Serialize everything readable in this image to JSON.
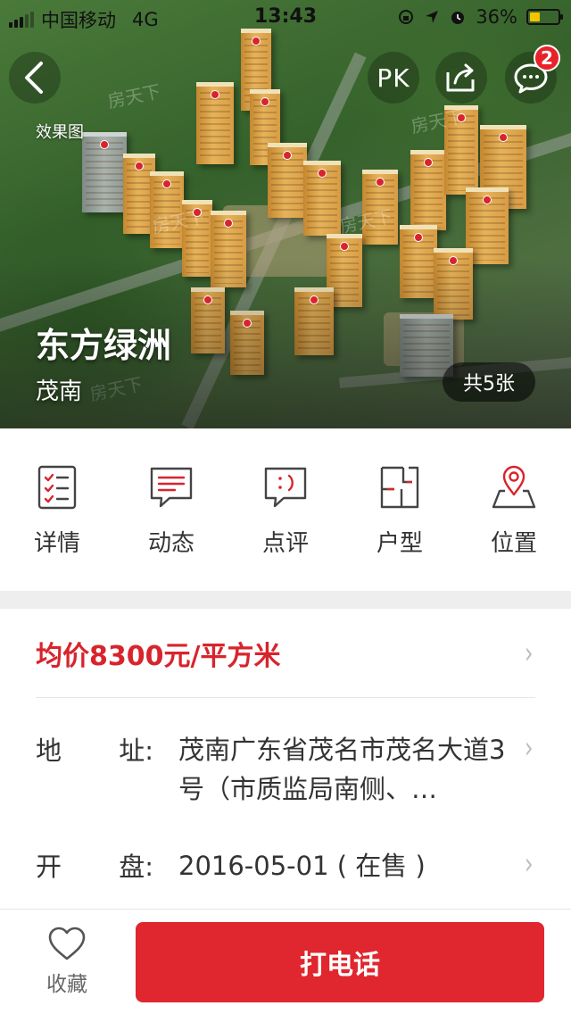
{
  "status_bar": {
    "carrier": "中国移动",
    "network": "4G",
    "time": "13:43",
    "battery": "36%",
    "battery_level": 0.36,
    "battery_color": "#f5c400"
  },
  "hero": {
    "effect_label": "效果图",
    "watermark": "房天下",
    "project_name": "东方绿洲",
    "district": "茂南",
    "photo_count": "共5张",
    "pk_label": "PK",
    "message_badge": "2",
    "icons": [
      "back-arrow-icon",
      "share-icon",
      "message-icon"
    ]
  },
  "quick_nav": [
    {
      "label": "详情",
      "icon": "details-list-icon"
    },
    {
      "label": "动态",
      "icon": "news-chat-icon"
    },
    {
      "label": "点评",
      "icon": "review-chat-icon"
    },
    {
      "label": "户型",
      "icon": "floorplan-icon"
    },
    {
      "label": "位置",
      "icon": "location-pin-icon"
    }
  ],
  "info": {
    "price": "均价8300元/平方米",
    "address_label_1": "地",
    "address_label_2": "址:",
    "address": "茂南广东省茂名市茂名大道3号（市质监局南侧、…",
    "opening_label_1": "开",
    "opening_label_2": "盘:",
    "opening": "2016-05-01 ( 在售 )"
  },
  "bottom_bar": {
    "favorite_label": "收藏",
    "call_label": "打电话"
  },
  "colors": {
    "accent": "#d8242c",
    "call_button": "#e0262e",
    "icon_stroke": "#444444"
  }
}
